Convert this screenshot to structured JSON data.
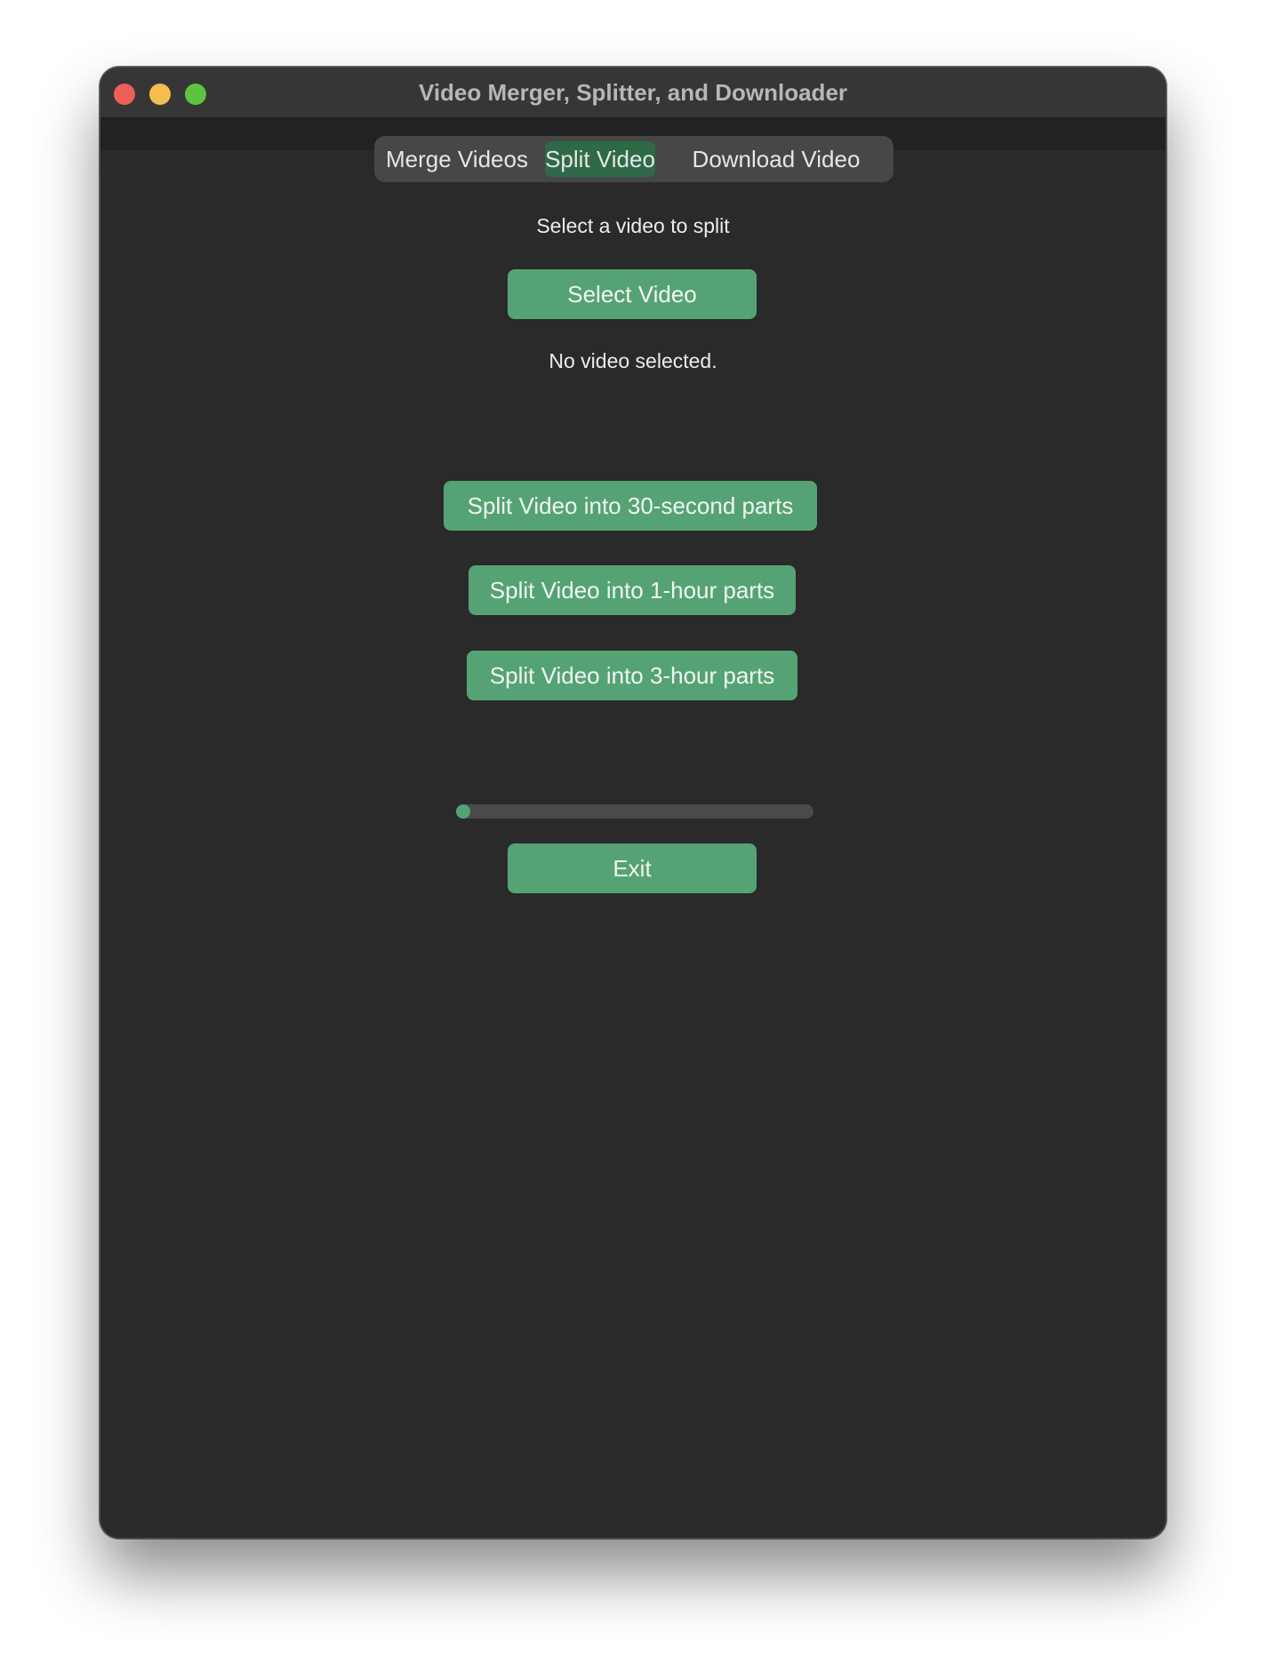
{
  "window": {
    "title": "Video Merger, Splitter, and Downloader"
  },
  "tabs": [
    {
      "label": "Merge Videos",
      "active": false
    },
    {
      "label": "Split Video",
      "active": true
    },
    {
      "label": "Download Video",
      "active": false
    }
  ],
  "split": {
    "prompt": "Select a video to split",
    "select_button": "Select Video",
    "status": "No video selected.",
    "split_30s_button": "Split Video into 30-second parts",
    "split_1h_button": "Split Video into 1-hour parts",
    "split_3h_button": "Split Video into 3-hour parts",
    "progress_percent": 0,
    "exit_button": "Exit"
  },
  "colors": {
    "button_green": "#55a374",
    "active_tab": "#2e6a48",
    "background": "#2a2a2a"
  }
}
